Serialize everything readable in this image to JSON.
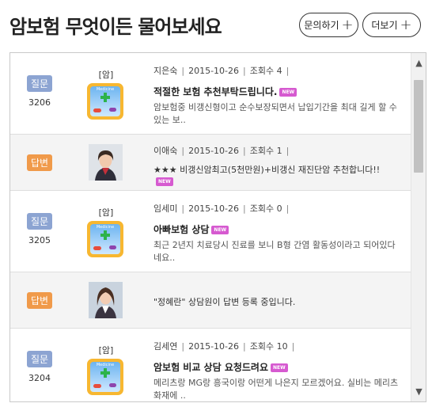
{
  "header": {
    "title": "암보험 무엇이든 물어보세요",
    "ask_button": "문의하기",
    "more_button": "더보기",
    "plus_symbol": "+"
  },
  "rows": [
    {
      "type": "question",
      "badge": "질문",
      "number": "3206",
      "category": "[암]",
      "author": "지은숙",
      "date": "2015-10-26",
      "views": "조회수 4",
      "title": "적절한 보험 추천부탁드립니다.",
      "new": "NEW",
      "desc": "암보험중 비갱신형이고 순수보장되면서 납입기간을 최대 길게 할 수 있는 보.."
    },
    {
      "type": "answer",
      "badge": "답변",
      "author": "이애숙",
      "date": "2015-10-26",
      "views": "조회수 1",
      "text": "★★★ 비갱신암최고(5천만원)+비갱신 재진단암 추천합니다!!",
      "new": "NEW"
    },
    {
      "type": "question",
      "badge": "질문",
      "number": "3205",
      "category": "[암]",
      "author": "임세미",
      "date": "2015-10-26",
      "views": "조회수 0",
      "title": "아빠보험 상담",
      "new": "NEW",
      "desc": "최근 2년지 치료당시 진료를 보니 B형 간염 활동성이라고 되어있다네요.."
    },
    {
      "type": "answer_status",
      "badge": "답변",
      "status": "\"정혜란\" 상담원이 답변 등록 중입니다."
    },
    {
      "type": "question",
      "badge": "질문",
      "number": "3204",
      "category": "[암]",
      "author": "김세연",
      "date": "2015-10-26",
      "views": "조회수 10",
      "title": "암보험 비교 상담 요청드려요",
      "new": "NEW",
      "desc": "메리츠랑 MG랑 흥국이랑 어떤게 나은지 모르겠어요. 실비는 메리츠화재에 .."
    }
  ],
  "meta_separator": "|",
  "app_icon_label": "Medicine",
  "scrollbar": {
    "up": "▲",
    "down": "▼"
  },
  "colors": {
    "question_badge": "#8ca4d2",
    "answer_badge": "#f09a4a",
    "new_badge": "#d65ad0",
    "answer_row_bg": "#f4f4f4"
  },
  "icons": [
    "plus-icon",
    "medicine-app-icon",
    "consultant-avatar",
    "chevron-up-icon",
    "chevron-down-icon"
  ]
}
